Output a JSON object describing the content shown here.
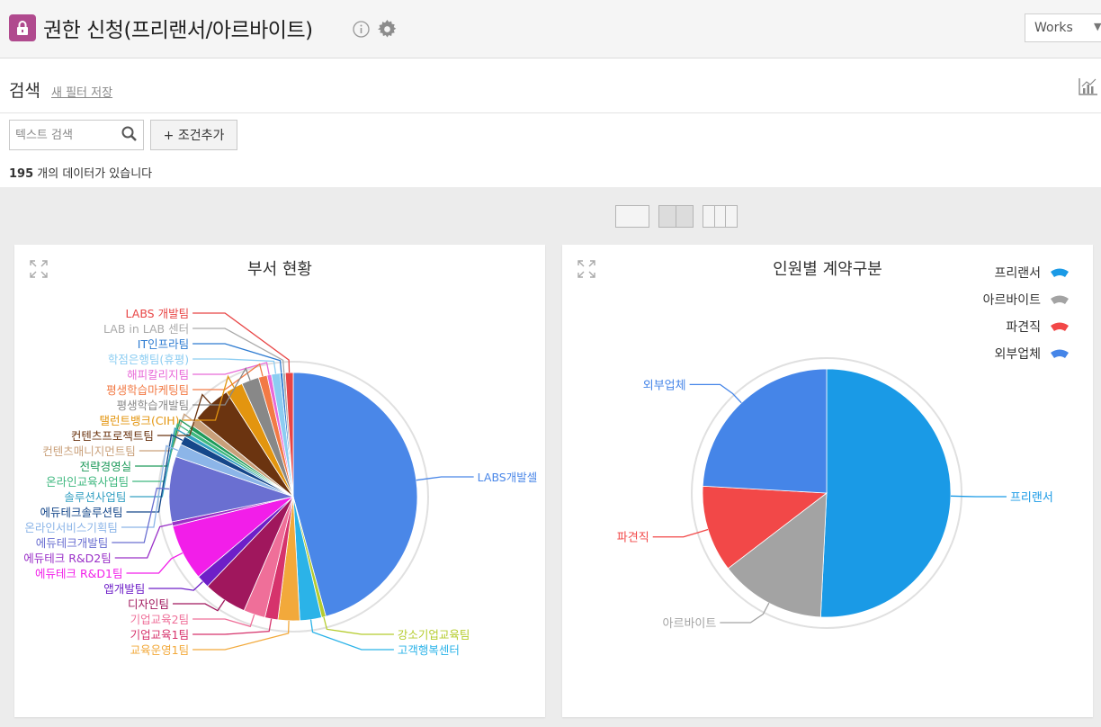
{
  "header": {
    "title": "권한 신청(프리랜서/아르바이트)",
    "view_select": "Works",
    "icons": {
      "lock": "lock-icon",
      "info": "info-icon",
      "settings": "gear-icon"
    }
  },
  "search": {
    "title": "검색",
    "new_filter_label": "새 필터 저장",
    "input_placeholder": "텍스트 검색",
    "add_condition_label": "+ 조건추가",
    "result_count": "195",
    "result_suffix": " 개의 데이터가 있습니다"
  },
  "layout_options": [
    "single",
    "double",
    "triple"
  ],
  "chart_data": [
    {
      "type": "pie",
      "title": "부서 현황",
      "slices": [
        {
          "label": "LABS개발셀",
          "value": 81,
          "color": "#4a87e8"
        },
        {
          "label": "강소기업교육팀",
          "value": 1,
          "color": "#b5cc2e"
        },
        {
          "label": "고객행복센터",
          "value": 5,
          "color": "#2bb3e8"
        },
        {
          "label": "교육운영1팀",
          "value": 5,
          "color": "#f2a93b"
        },
        {
          "label": "기업교육1팀",
          "value": 3,
          "color": "#d6336c"
        },
        {
          "label": "기업교육2팀",
          "value": 5,
          "color": "#ef6f99"
        },
        {
          "label": "디자인팀",
          "value": 10,
          "color": "#a0175d"
        },
        {
          "label": "앱개발팀",
          "value": 3,
          "color": "#6e1fc8"
        },
        {
          "label": "에듀테크 R&D1팀",
          "value": 13,
          "color": "#f21ee9"
        },
        {
          "label": "에듀테크 R&D2팀",
          "value": 1,
          "color": "#9a31c8"
        },
        {
          "label": "에듀테크개발팀",
          "value": 15,
          "color": "#6a6fd1"
        },
        {
          "label": "온라인서비스기획팀",
          "value": 3,
          "color": "#8cb5e8"
        },
        {
          "label": "에듀테크솔루션팀",
          "value": 2,
          "color": "#15478a"
        },
        {
          "label": "솔루션사업팀",
          "value": 1,
          "color": "#34a0c2"
        },
        {
          "label": "온라인교육사업팀",
          "value": 1,
          "color": "#3fb87f"
        },
        {
          "label": "전략경영실",
          "value": 1,
          "color": "#1d9a5a"
        },
        {
          "label": "컨텐츠매니지먼트팀",
          "value": 2,
          "color": "#c9a07a"
        },
        {
          "label": "컨텐츠프로젝트팀",
          "value": 9,
          "color": "#6b3410"
        },
        {
          "label": "탤런트뱅크(CIH)",
          "value": 4,
          "color": "#e3950f"
        },
        {
          "label": "평생학습개발팀",
          "value": 4,
          "color": "#888888"
        },
        {
          "label": "평생학습마케팅팀",
          "value": 2,
          "color": "#f27a45"
        },
        {
          "label": "해피칼리지팀",
          "value": 1,
          "color": "#e86ad8"
        },
        {
          "label": "학점은행팀(휴평)",
          "value": 2,
          "color": "#8ccdf2"
        },
        {
          "label": "IT인프라팀",
          "value": 0.6,
          "color": "#2d7bd1"
        },
        {
          "label": "LAB in LAB 센터",
          "value": 0.6,
          "color": "#aaaaaa"
        },
        {
          "label": "LABS 개발팀",
          "value": 1.8,
          "color": "#e84545"
        }
      ]
    },
    {
      "type": "pie",
      "title": "인원별 계약구분",
      "legend": "top-right",
      "slices": [
        {
          "label": "프리랜서",
          "value": 99,
          "color": "#1a9ae6"
        },
        {
          "label": "아르바이트",
          "value": 27,
          "color": "#a3a3a3"
        },
        {
          "label": "파견직",
          "value": 22,
          "color": "#f24848"
        },
        {
          "label": "외부업체",
          "value": 47,
          "color": "#4585e8"
        }
      ]
    }
  ]
}
